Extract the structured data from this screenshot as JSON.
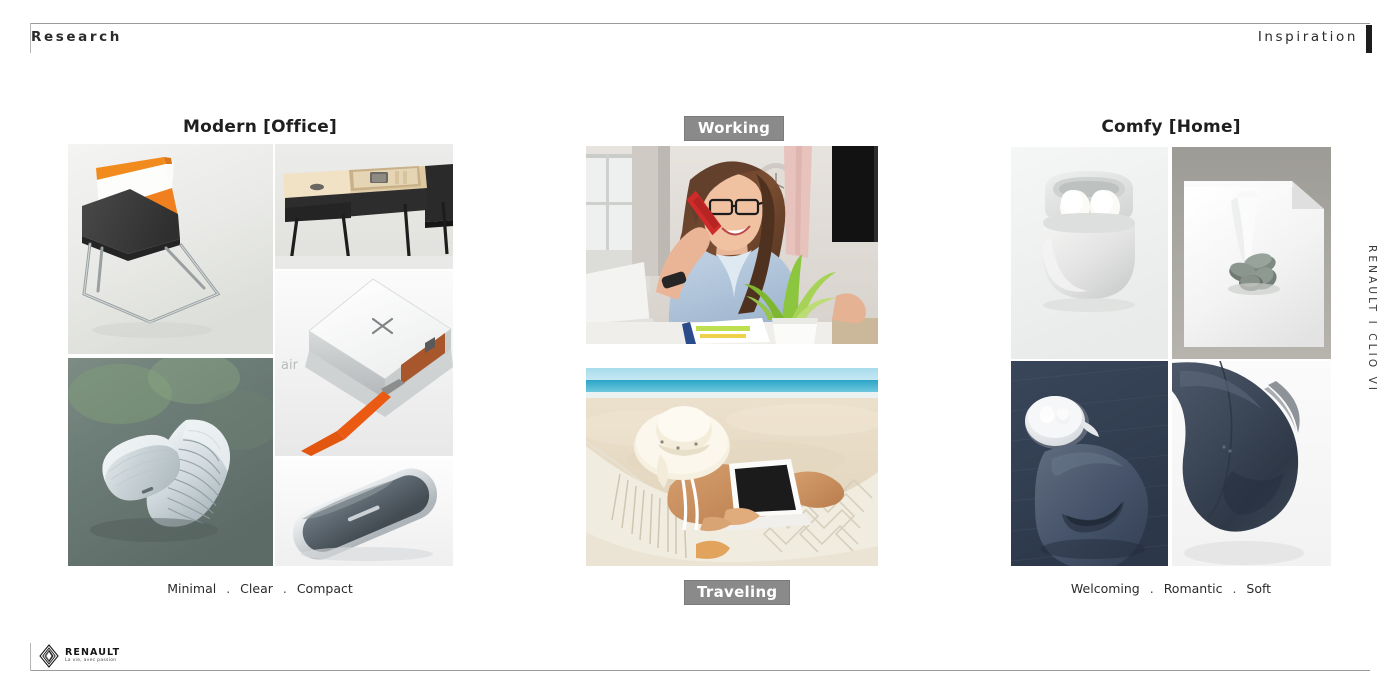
{
  "header": {
    "left_label": "Research",
    "right_label": "Inspiration"
  },
  "side": {
    "vertical_label": "RENAULT  I  CLIO VI"
  },
  "footer": {
    "brand": "RENAULT",
    "tagline": "La vie, avec passion"
  },
  "columns": {
    "left": {
      "title": "Modern [Office]",
      "caption_words": [
        "Minimal",
        "Clear",
        "Compact"
      ],
      "caption": "Minimal . Clear . Compact",
      "tiles": [
        {
          "name": "orange-grey-lounge-chair",
          "alt": "Modern lounge chair with orange and dark grey upholstery on steel sled base"
        },
        {
          "name": "wooden-desk-organizer",
          "alt": "Light wood desk with built-in organizer tray on black desk top"
        },
        {
          "name": "white-wireless-charger",
          "alt": "White square wireless charging pad with X mark and orange USB cable"
        },
        {
          "name": "aluminium-external-drive",
          "alt": "Silver and grey rounded external hard drive"
        },
        {
          "name": "ribbed-aluminium-speakers",
          "alt": "Two brushed aluminium ribbed pebble-shaped devices on grey surface"
        }
      ]
    },
    "center": {
      "top_tag": "Working",
      "bottom_tag": "Traveling",
      "tiles": [
        {
          "name": "woman-on-phone-at-desk",
          "alt": "Smiling woman with glasses on a red phone at a bright desk with laptop and plant"
        },
        {
          "name": "woman-in-hammock-with-laptop",
          "alt": "Woman in sun hat lying in a beach hammock using a laptop"
        }
      ]
    },
    "right": {
      "title": "Comfy [Home]",
      "caption_words": [
        "Welcoming",
        "Romantic",
        "Soft"
      ],
      "caption": "Welcoming . Romantic . Soft",
      "tiles": [
        {
          "name": "white-earbuds-case",
          "alt": "White ceramic earbud charging case with two white earbuds"
        },
        {
          "name": "white-tray-with-pebbles",
          "alt": "White faceted tray holding grey pebbles"
        },
        {
          "name": "navy-soft-cushion-object",
          "alt": "Soft navy squircle cushion object with white disc on dark blue fabric"
        },
        {
          "name": "navy-curved-device",
          "alt": "Close-up of a matte navy curved device form"
        }
      ]
    }
  },
  "colors": {
    "rule": "#9a9a9a",
    "text": "#231f20",
    "chip_bg": "#8a8a8a",
    "accent_orange": "#f07e22",
    "navy": "#3c4756"
  }
}
